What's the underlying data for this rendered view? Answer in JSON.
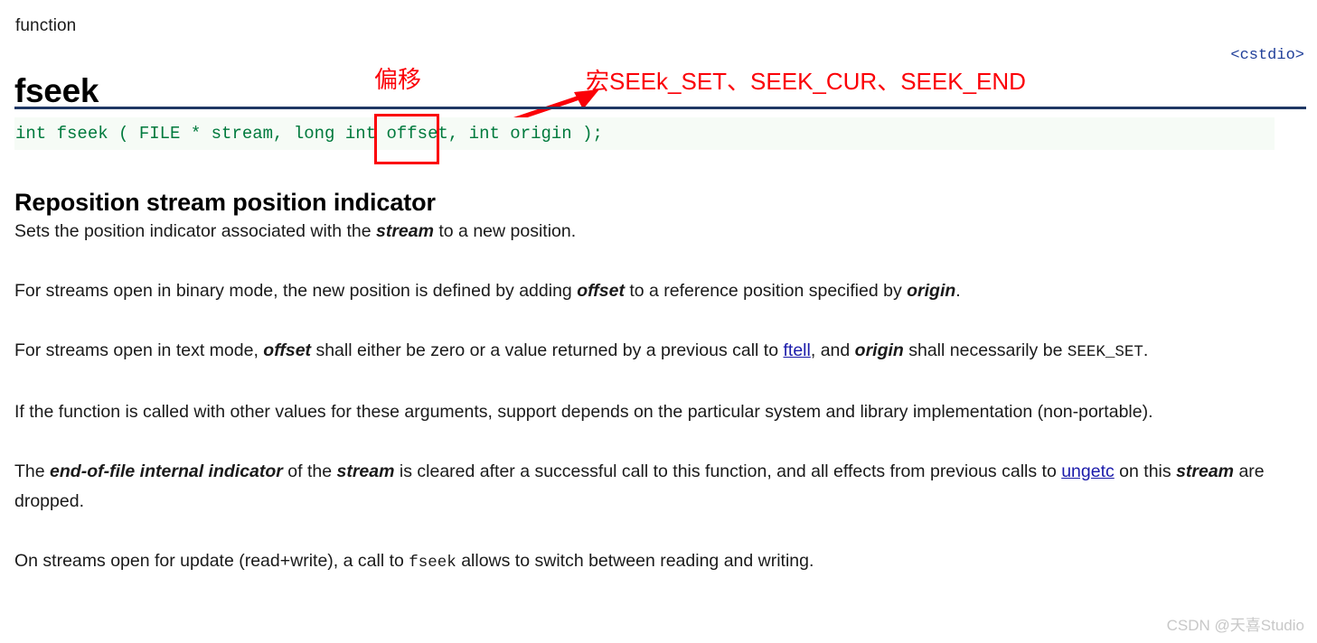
{
  "header": {
    "kind_label": "function",
    "function_name": "fseek",
    "include_header": "<cstdio>"
  },
  "signature": {
    "code": "int fseek ( FILE * stream, long int offset, int origin );",
    "code_color": "#007a3d",
    "background": "#f6fbf6"
  },
  "annotations": {
    "offset_note": "偏移",
    "macros_note": "宏SEEk_SET、SEEK_CUR、SEEK_END",
    "color": "#fb0007",
    "box_target": "offset",
    "arrow_from": "signature-origin-parameter",
    "arrow_to": "macros-note"
  },
  "section": {
    "heading": "Reposition stream position indicator"
  },
  "paragraphs": [
    {
      "id": "p1",
      "parts": [
        {
          "type": "text",
          "text": "Sets the position indicator associated with the "
        },
        {
          "type": "term",
          "text": "stream"
        },
        {
          "type": "text",
          "text": " to a new position."
        }
      ]
    },
    {
      "id": "p2",
      "parts": [
        {
          "type": "text",
          "text": "For streams open in binary mode, the new position is defined by adding "
        },
        {
          "type": "term",
          "text": "offset"
        },
        {
          "type": "text",
          "text": " to a reference position specified by "
        },
        {
          "type": "term",
          "text": "origin"
        },
        {
          "type": "text",
          "text": "."
        }
      ]
    },
    {
      "id": "p3",
      "parts": [
        {
          "type": "text",
          "text": "For streams open in text mode, "
        },
        {
          "type": "term",
          "text": "offset"
        },
        {
          "type": "text",
          "text": " shall either be zero or a value returned by a previous call to "
        },
        {
          "type": "link",
          "text": "ftell"
        },
        {
          "type": "text",
          "text": ", and "
        },
        {
          "type": "term",
          "text": "origin"
        },
        {
          "type": "text",
          "text": " shall necessarily be "
        },
        {
          "type": "code",
          "text": "SEEK_SET"
        },
        {
          "type": "text",
          "text": "."
        }
      ]
    },
    {
      "id": "p4",
      "parts": [
        {
          "type": "text",
          "text": "If the function is called with other values for these arguments, support depends on the particular system and library implementation (non-portable)."
        }
      ]
    },
    {
      "id": "p5",
      "parts": [
        {
          "type": "text",
          "text": "The "
        },
        {
          "type": "term",
          "text": "end-of-file internal indicator"
        },
        {
          "type": "text",
          "text": " of the "
        },
        {
          "type": "term",
          "text": "stream"
        },
        {
          "type": "text",
          "text": " is cleared after a successful call to this function, and all effects from previous calls to "
        },
        {
          "type": "link",
          "text": "ungetc"
        },
        {
          "type": "text",
          "text": " on this "
        },
        {
          "type": "term",
          "text": "stream"
        },
        {
          "type": "text",
          "text": " are dropped."
        }
      ]
    },
    {
      "id": "p6",
      "parts": [
        {
          "type": "text",
          "text": "On streams open for update (read+write), a call to "
        },
        {
          "type": "code",
          "text": "fseek"
        },
        {
          "type": "text",
          "text": " allows to switch between reading and writing."
        }
      ]
    }
  ],
  "watermark": {
    "text": "CSDN @天喜Studio"
  }
}
